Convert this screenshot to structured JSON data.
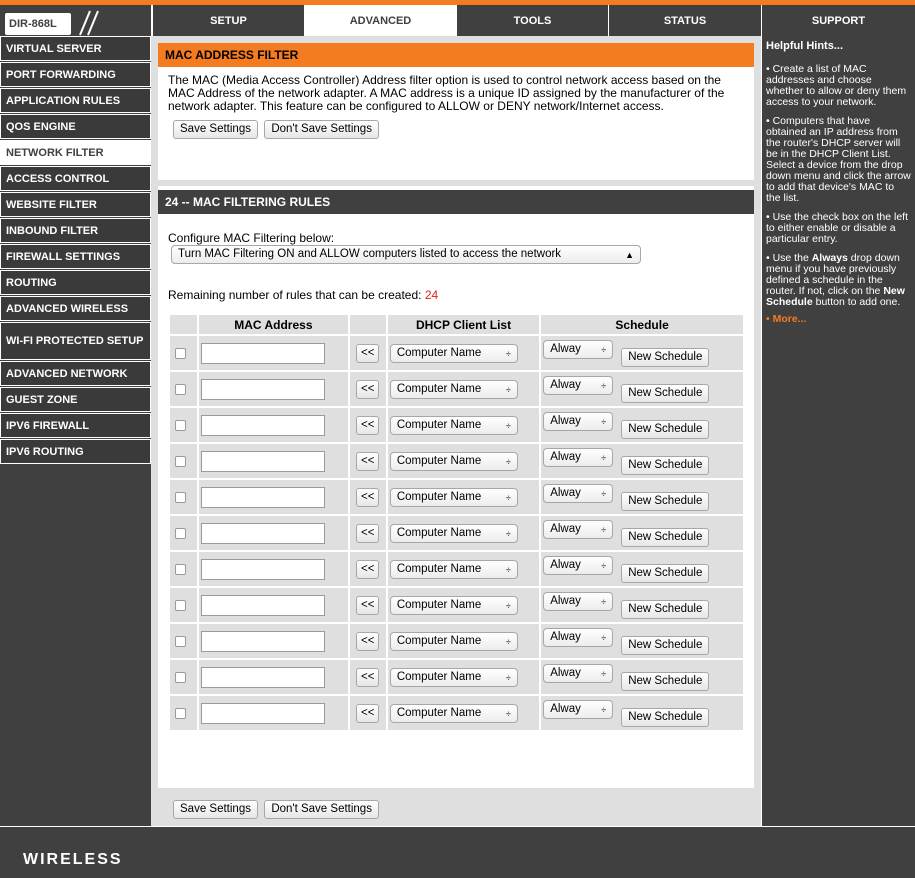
{
  "header": {
    "model": "DIR-868L",
    "tabs": [
      {
        "label": "SETUP",
        "active": false
      },
      {
        "label": "ADVANCED",
        "active": true
      },
      {
        "label": "TOOLS",
        "active": false
      },
      {
        "label": "STATUS",
        "active": false
      },
      {
        "label": "SUPPORT",
        "active": false
      }
    ]
  },
  "sidebar": {
    "items": [
      {
        "label": "VIRTUAL SERVER",
        "active": false
      },
      {
        "label": "PORT FORWARDING",
        "active": false
      },
      {
        "label": "APPLICATION RULES",
        "active": false
      },
      {
        "label": "QOS ENGINE",
        "active": false
      },
      {
        "label": "NETWORK FILTER",
        "active": true
      },
      {
        "label": "ACCESS CONTROL",
        "active": false
      },
      {
        "label": "WEBSITE FILTER",
        "active": false
      },
      {
        "label": "INBOUND FILTER",
        "active": false
      },
      {
        "label": "FIREWALL SETTINGS",
        "active": false
      },
      {
        "label": "ROUTING",
        "active": false
      },
      {
        "label": "ADVANCED WIRELESS",
        "active": false
      },
      {
        "label": "WI-FI PROTECTED SETUP",
        "active": false
      },
      {
        "label": "ADVANCED NETWORK",
        "active": false
      },
      {
        "label": "GUEST ZONE",
        "active": false
      },
      {
        "label": "IPV6 FIREWALL",
        "active": false
      },
      {
        "label": "IPV6 ROUTING",
        "active": false
      }
    ]
  },
  "mac_filter": {
    "title": "MAC ADDRESS FILTER",
    "description": "The MAC (Media Access Controller) Address filter option is used to control network access based on the MAC Address of the network adapter. A MAC address is a unique ID assigned by the manufacturer of the network adapter. This feature can be configured to ALLOW or DENY network/Internet access.",
    "save_label": "Save Settings",
    "dont_save_label": "Don't Save Settings"
  },
  "rules": {
    "title": "24 -- MAC FILTERING RULES",
    "configure_label": "Configure MAC Filtering below:",
    "mode_selected": "Turn MAC Filtering ON and ALLOW computers listed to access the network",
    "remaining_label": "Remaining number of rules that can be created:",
    "remaining_count": "24",
    "columns": {
      "mac": "MAC Address",
      "dhcp": "DHCP Client List",
      "schedule": "Schedule"
    },
    "copy_button": "<<",
    "computer_name": "Computer Name",
    "schedule_value": "Alway",
    "new_schedule": "New Schedule",
    "row_count": 11
  },
  "bottom_buttons": {
    "save_label": "Save Settings",
    "dont_save_label": "Don't Save Settings"
  },
  "hints": {
    "title": "Helpful Hints...",
    "items": [
      "• Create a list of MAC addresses and choose whether to allow or deny them access to your network.",
      "• Computers that have obtained an IP address from the router's DHCP server will be in the DHCP Client List. Select a device from the drop down menu and click the arrow to add that device's MAC to the list.",
      "• Use the check box on the left to either enable or disable a particular entry."
    ],
    "hint4": {
      "p1": "• Use the ",
      "b1": "Always",
      "p2": " drop down menu if you have previously defined a schedule in the router. If not, click on the ",
      "b2": "New Schedule",
      "p3": " button to add one."
    },
    "more": "• More..."
  },
  "footer": {
    "brand_text": "WIRELESS"
  },
  "colors": {
    "accent": "#f47b20",
    "dark": "#404040",
    "panel": "#dfdfdf",
    "alert": "#e0201a"
  }
}
